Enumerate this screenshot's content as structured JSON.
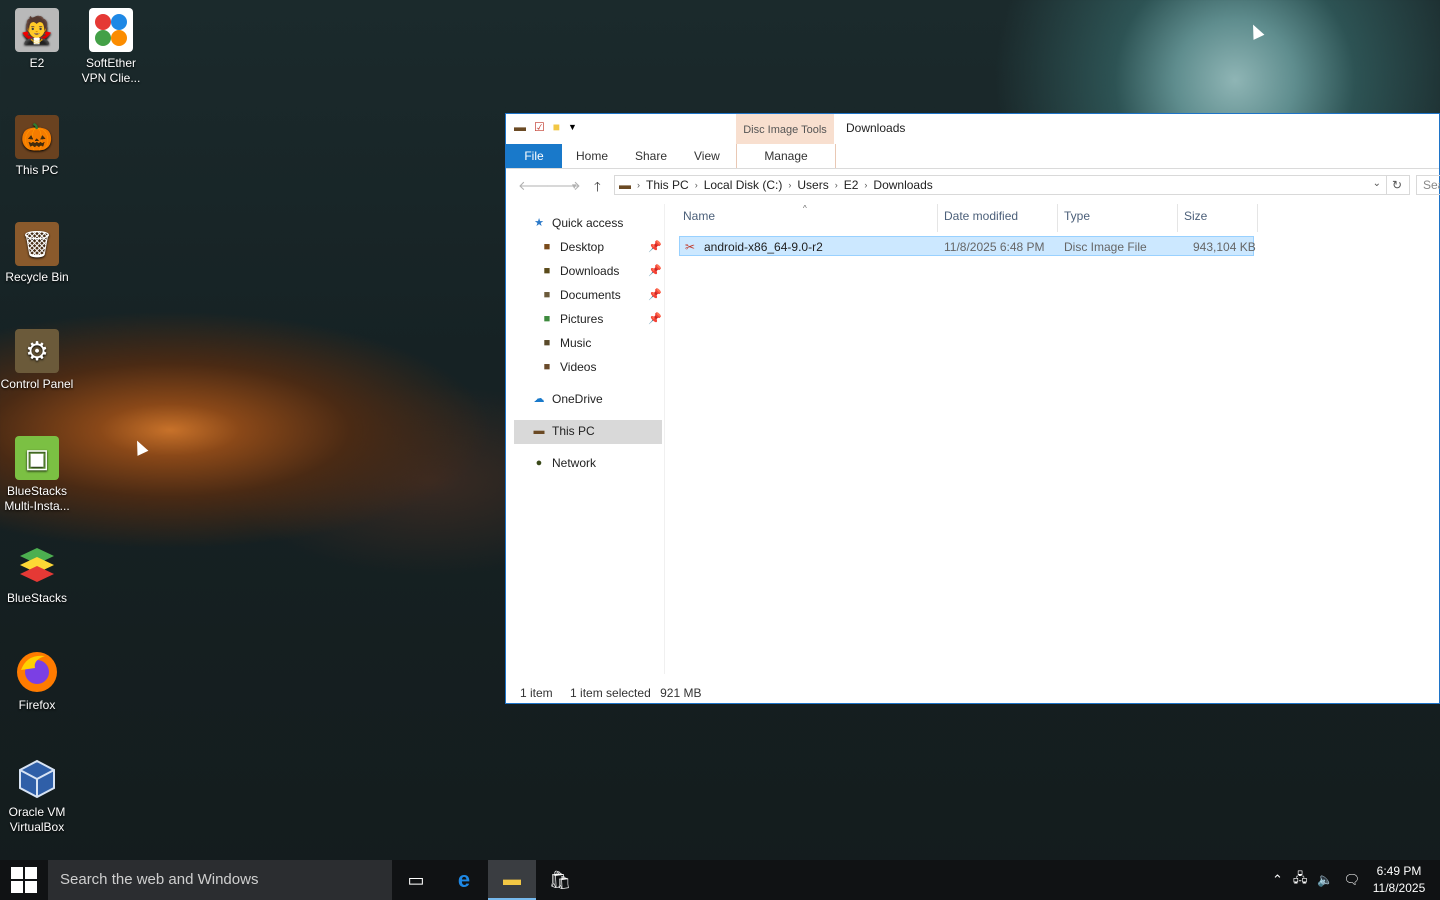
{
  "desktop": {
    "icons": [
      {
        "label": "E2",
        "glyph": "🧛",
        "bg": "#c8c8c8"
      },
      {
        "label": "SoftEther VPN Clie...",
        "glyph": "⬤",
        "bg": "#ffffff"
      },
      {
        "label": "This PC",
        "glyph": "🎃",
        "bg": "#5a3a1c"
      },
      {
        "label": "Recycle Bin",
        "glyph": "🗑",
        "bg": "#8a5a2c"
      },
      {
        "label": "Control Panel",
        "glyph": "⚙",
        "bg": "#6a5a3a"
      },
      {
        "label": "BlueStacks Multi-Insta...",
        "glyph": "▣",
        "bg": "#4caf50"
      },
      {
        "label": "BlueStacks",
        "glyph": "◆",
        "bg": "#2f9e44"
      },
      {
        "label": "Firefox",
        "glyph": "🦊",
        "bg": "#ff7b00"
      },
      {
        "label": "Oracle VM VirtualBox",
        "glyph": "⬡",
        "bg": "#2f5fa8"
      }
    ]
  },
  "explorer": {
    "ribbon_context_label": "Disc Image Tools",
    "title": "Downloads",
    "tabs": {
      "file": "File",
      "home": "Home",
      "share": "Share",
      "view": "View",
      "manage": "Manage"
    },
    "breadcrumb": [
      "This PC",
      "Local Disk (C:)",
      "Users",
      "E2",
      "Downloads"
    ],
    "search_placeholder": "Sea",
    "nav": {
      "quick_access": "Quick access",
      "desktop": "Desktop",
      "downloads": "Downloads",
      "documents": "Documents",
      "pictures": "Pictures",
      "music": "Music",
      "videos": "Videos",
      "onedrive": "OneDrive",
      "this_pc": "This PC",
      "network": "Network"
    },
    "columns": {
      "name": "Name",
      "date": "Date modified",
      "type": "Type",
      "size": "Size"
    },
    "files": [
      {
        "name": "android-x86_64-9.0-r2",
        "date": "11/8/2025 6:48 PM",
        "type": "Disc Image File",
        "size": "943,104 KB"
      }
    ],
    "status": {
      "count": "1 item",
      "selected": "1 item selected",
      "size": "921 MB"
    }
  },
  "taskbar": {
    "search_text": "Search the web and Windows",
    "time": "6:49 PM",
    "date": "11/8/2025"
  },
  "colors": {
    "accent": "#1979ca",
    "selection": "#cce8ff",
    "context_tab": "#f8dfcf"
  }
}
